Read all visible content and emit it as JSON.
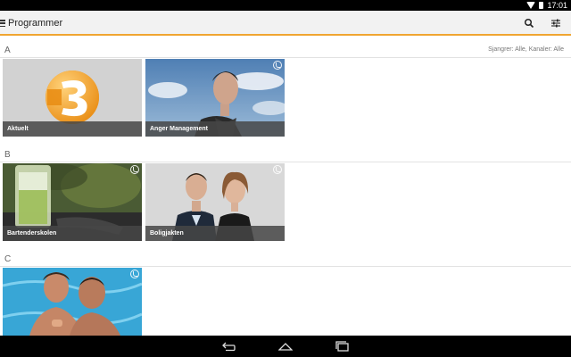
{
  "status_bar": {
    "time": "17:01"
  },
  "app_bar": {
    "title": "Programmer"
  },
  "sections": [
    {
      "letter": "A",
      "filter_info": "Sjangrer: Alle, Kanaler: Alle",
      "tiles": [
        {
          "caption": "Aktuelt"
        },
        {
          "caption": "Anger Management"
        }
      ]
    },
    {
      "letter": "B",
      "tiles": [
        {
          "caption": "Bartenderskolen"
        },
        {
          "caption": "Boligjakten"
        }
      ]
    },
    {
      "letter": "C",
      "tiles": [
        {
          "caption": ""
        }
      ]
    }
  ],
  "colors": {
    "accent": "#f0a531",
    "tv3_orange": "#f3a02b"
  },
  "icons": [
    "menu-icon",
    "search-icon",
    "filter-sliders-icon",
    "channel-badge-icon",
    "back-icon",
    "home-icon",
    "recents-icon",
    "wifi-icon",
    "battery-icon"
  ]
}
